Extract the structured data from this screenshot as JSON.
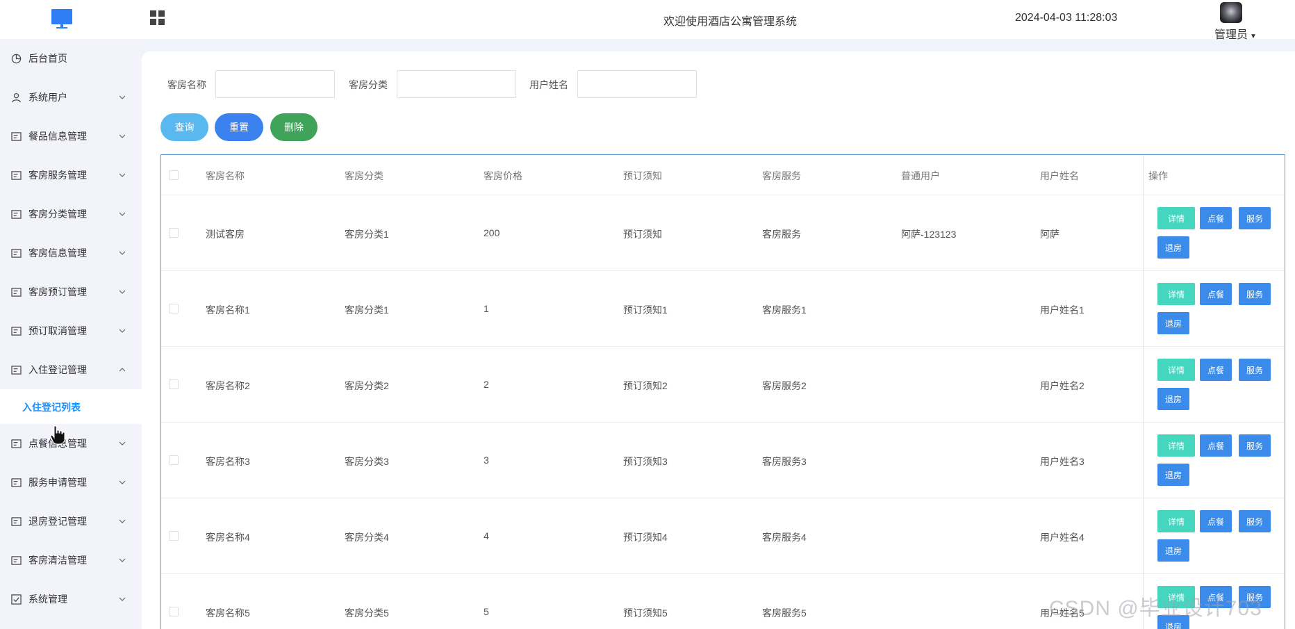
{
  "header": {
    "title": "欢迎使用酒店公寓管理系统",
    "datetime": "2024-04-03 11:28:03",
    "user_label": "管理员"
  },
  "sidebar": {
    "items": [
      {
        "label": "后台首页",
        "icon": "pie-chart-icon",
        "arrow": ""
      },
      {
        "label": "系统用户",
        "icon": "user-icon",
        "arrow": "chevron-down"
      },
      {
        "label": "餐品信息管理",
        "icon": "list-icon",
        "arrow": "chevron-down"
      },
      {
        "label": "客房服务管理",
        "icon": "list-icon",
        "arrow": "chevron-down"
      },
      {
        "label": "客房分类管理",
        "icon": "list-icon",
        "arrow": "chevron-down"
      },
      {
        "label": "客房信息管理",
        "icon": "list-icon",
        "arrow": "chevron-down"
      },
      {
        "label": "客房预订管理",
        "icon": "list-icon",
        "arrow": "chevron-down"
      },
      {
        "label": "预订取消管理",
        "icon": "list-icon",
        "arrow": "chevron-down"
      },
      {
        "label": "入住登记管理",
        "icon": "list-icon",
        "arrow": "chevron-up"
      },
      {
        "label": "点餐信息管理",
        "icon": "list-icon",
        "arrow": "chevron-down"
      },
      {
        "label": "服务申请管理",
        "icon": "list-icon",
        "arrow": "chevron-down"
      },
      {
        "label": "退房登记管理",
        "icon": "list-icon",
        "arrow": "chevron-down"
      },
      {
        "label": "客房清洁管理",
        "icon": "list-icon",
        "arrow": "chevron-down"
      },
      {
        "label": "系统管理",
        "icon": "settings-icon",
        "arrow": "chevron-down"
      }
    ],
    "active_sub": "入住登记列表"
  },
  "search": {
    "fields": [
      {
        "label": "客房名称",
        "value": "",
        "placeholder": ""
      },
      {
        "label": "客房分类",
        "value": "",
        "placeholder": ""
      },
      {
        "label": "用户姓名",
        "value": "",
        "placeholder": ""
      }
    ],
    "query_label": "查询",
    "reset_label": "重置",
    "delete_label": "删除"
  },
  "colors": {
    "query": "#5ab8f0",
    "reset": "#3b82f0",
    "delete": "#3fa45a",
    "detail": "#45d6c0",
    "action": "#3b8bea",
    "active_link": "#1890ff"
  },
  "table": {
    "columns": [
      "客房名称",
      "客房分类",
      "客房价格",
      "预订须知",
      "客房服务",
      "普通用户",
      "用户姓名",
      "操作"
    ],
    "rows": [
      [
        "测试客房",
        "客房分类1",
        "200",
        "预订须知",
        "客房服务",
        "阿萨-123123",
        "阿萨"
      ],
      [
        "客房名称1",
        "客房分类1",
        "1",
        "预订须知1",
        "客房服务1",
        "",
        "用户姓名1"
      ],
      [
        "客房名称2",
        "客房分类2",
        "2",
        "预订须知2",
        "客房服务2",
        "",
        "用户姓名2"
      ],
      [
        "客房名称3",
        "客房分类3",
        "3",
        "预订须知3",
        "客房服务3",
        "",
        "用户姓名3"
      ],
      [
        "客房名称4",
        "客房分类4",
        "4",
        "预订须知4",
        "客房服务4",
        "",
        "用户姓名4"
      ],
      [
        "客房名称5",
        "客房分类5",
        "5",
        "预订须知5",
        "客房服务5",
        "",
        "用户姓名5"
      ]
    ],
    "actions": {
      "detail": "详情",
      "order": "点餐",
      "service": "服务",
      "checkout": "退房"
    }
  },
  "watermark": "CSDN @毕业设计703"
}
